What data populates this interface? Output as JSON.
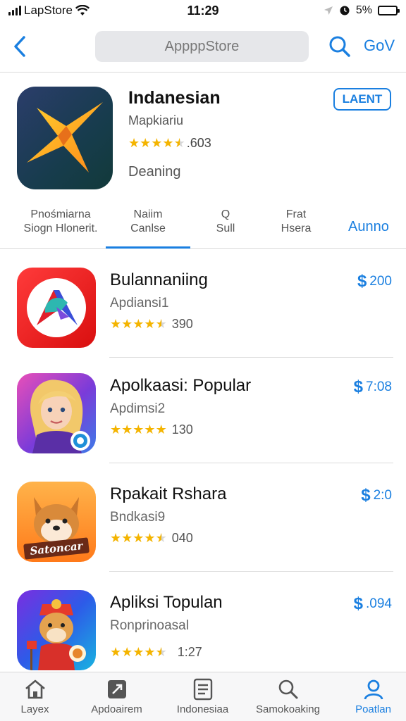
{
  "status_bar": {
    "carrier": "LapStore",
    "time": "11:29",
    "battery": "5%",
    "battery_level": 0.05
  },
  "nav": {
    "search_text": "AppppStore",
    "action_label": "GoV"
  },
  "featured": {
    "title": "Indanesian",
    "subtitle": "Mapkiariu",
    "rating_value": 4.5,
    "rating_text": ".603",
    "status": "Deaning",
    "button_label": "LAENT"
  },
  "tabs": {
    "items": [
      {
        "line1": "Pnośmiarna",
        "line2": "Siogn Hlonerit."
      },
      {
        "line1": "Naiim",
        "line2": "Canlse"
      },
      {
        "line1": "Q",
        "line2": "Sull"
      },
      {
        "line1": "Frat",
        "line2": "Hsera"
      }
    ],
    "link_label": "Aunno"
  },
  "apps": [
    {
      "title": "Bulannaniing",
      "subtitle": "Apdiansi1",
      "rating": 4.5,
      "count": "390",
      "price": "200"
    },
    {
      "title": "Apolkaasi: Popular",
      "subtitle": "Apdimsi2",
      "rating": 5,
      "count": "130",
      "price": "7:08"
    },
    {
      "title": "Rpakait Rshara",
      "subtitle": "Bndkasi9",
      "rating": 4.5,
      "count": "040",
      "price": "2:0"
    },
    {
      "title": "Apliksi Topulan",
      "subtitle": "Ronprinoasal",
      "rating": 4.5,
      "count": "1:27",
      "price": ".094"
    }
  ],
  "icon_text": {
    "sausage": "Satoncar"
  },
  "tab_bar": {
    "items": [
      {
        "label": "Layex",
        "icon": "house-icon"
      },
      {
        "label": "Apdoairem",
        "icon": "apps-icon"
      },
      {
        "label": "Indonesiaa",
        "icon": "document-icon"
      },
      {
        "label": "Samokoaking",
        "icon": "search-icon"
      },
      {
        "label": "Poatlan",
        "icon": "person-icon"
      }
    ]
  },
  "colors": {
    "accent": "#1a7fe0",
    "star": "#f4b400"
  }
}
